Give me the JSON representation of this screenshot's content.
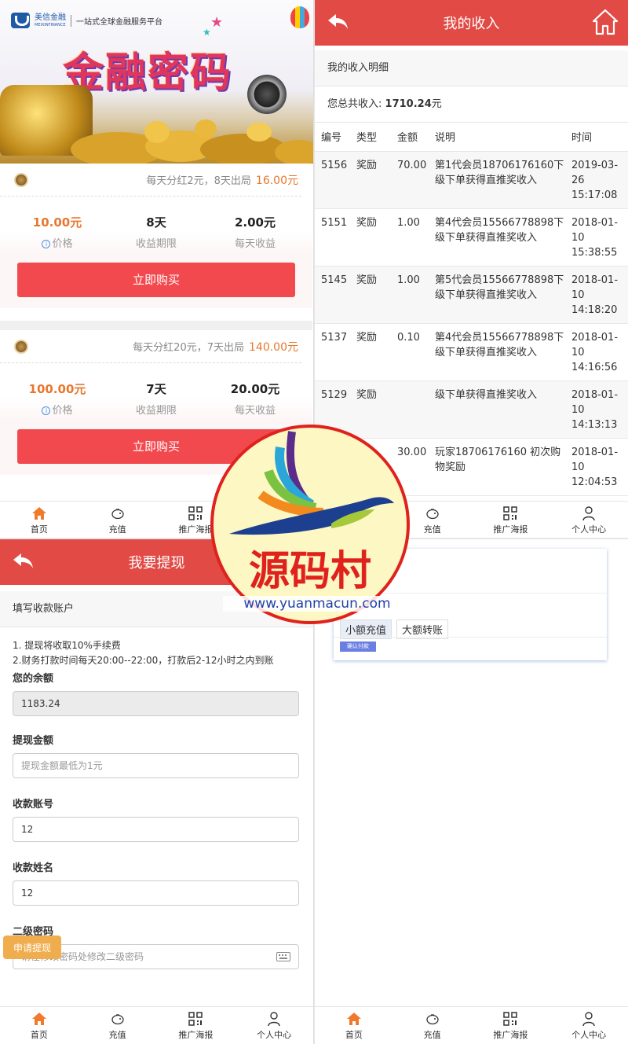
{
  "home": {
    "banner": {
      "brand_name": "美信金融",
      "brand_en": "MEIXINFINANCE",
      "brand_tagline": "一站式全球金融服务平台",
      "title": "金融密码"
    },
    "products": [
      {
        "desc": "每天分红2元，8天出局",
        "price_tag": "16.00元",
        "price": "10.00元",
        "price_label": "价格",
        "period": "8天",
        "period_label": "收益期限",
        "daily": "2.00元",
        "daily_label": "每天收益",
        "buy_label": "立即购买"
      },
      {
        "desc": "每天分红20元，7天出局",
        "price_tag": "140.00元",
        "price": "100.00元",
        "price_label": "价格",
        "period": "7天",
        "period_label": "收益期限",
        "daily": "20.00元",
        "daily_label": "每天收益",
        "buy_label": "立即购买"
      }
    ]
  },
  "tabbar": {
    "home": "首页",
    "recharge": "充值",
    "poster": "推广海报",
    "profile": "个人中心"
  },
  "income": {
    "title": "我的收入",
    "section": "我的收入明细",
    "total_label": "您总共收入:",
    "total_value": "1710.24",
    "total_unit": "元",
    "headers": [
      "编号",
      "类型",
      "金额",
      "说明",
      "时间"
    ],
    "rows": [
      {
        "id": "5156",
        "type": "奖励",
        "amount": "70.00",
        "desc": "第1代会员18706176160下级下单获得直推奖收入",
        "time": "2019-03-26 15:17:08"
      },
      {
        "id": "5151",
        "type": "奖励",
        "amount": "1.00",
        "desc": "第4代会员15566778898下级下单获得直推奖收入",
        "time": "2018-01-10 15:38:55"
      },
      {
        "id": "5145",
        "type": "奖励",
        "amount": "1.00",
        "desc": "第5代会员15566778898下级下单获得直推奖收入",
        "time": "2018-01-10 14:18:20"
      },
      {
        "id": "5137",
        "type": "奖励",
        "amount": "0.10",
        "desc": "第4代会员15566778898下级下单获得直推奖收入",
        "time": "2018-01-10 14:16:56"
      },
      {
        "id": "5129",
        "type": "奖励",
        "amount": "",
        "desc": "级下单获得直推奖收入",
        "time": "2018-01-10 14:13:13"
      },
      {
        "id": "",
        "type": "",
        "amount": "30.00",
        "desc": "玩家18706176160 初次购物奖励",
        "time": "2018-01-10 12:04:53"
      }
    ]
  },
  "withdraw": {
    "title": "我要提现",
    "section": "填写收款账户",
    "note1": "1. 提现将收取10%手续费",
    "note2": "2.财务打款时间每天20:00--22:00，打款后2-12小时之内到账",
    "balance_label": "您的余额",
    "balance_value": "1183.24",
    "amount_label": "提现金额",
    "amount_placeholder": "提现金额最低为1元",
    "account_label": "收款账号",
    "account_value": "12",
    "name_label": "收款姓名",
    "name_value": "12",
    "password_label": "二级密码",
    "password_placeholder": "请在修改密码处修改二级密码",
    "submit_label": "申请提现"
  },
  "recharge": {
    "tab_small": "小额充值",
    "tab_large": "大额转账",
    "pay_label": "确认付款"
  },
  "watermark": {
    "text": "源码村",
    "url": "www.yuanmacun.com"
  },
  "colors": {
    "header_red": "#e14a45",
    "buy_red": "#f2494e",
    "price_orange": "#e8772e",
    "submit_orange": "#f0ad4e"
  }
}
